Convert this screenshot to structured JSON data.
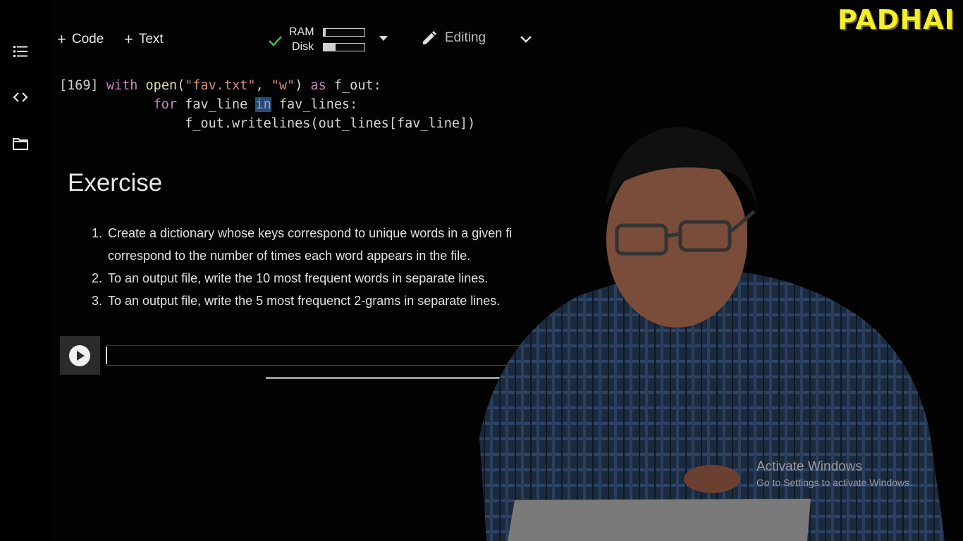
{
  "brand": {
    "logo_text": "PADHAI",
    "logo_color": "#f5ef2a"
  },
  "sidebar": {
    "items": [
      {
        "icon": "table-of-contents-icon"
      },
      {
        "icon": "code-snippets-icon"
      },
      {
        "icon": "folder-icon"
      }
    ]
  },
  "toolbar": {
    "add_code_label": "Code",
    "add_text_label": "Text",
    "resources": {
      "ram_label": "RAM",
      "disk_label": "Disk",
      "ram_usage": 0.05,
      "disk_usage": 0.3,
      "status_icon": "check-icon"
    },
    "mode_label": "Editing"
  },
  "code_cell": {
    "execution_count": "[169]",
    "lines": [
      [
        "with",
        " ",
        "open",
        "(",
        "\"fav.txt\"",
        ", ",
        "\"w\"",
        ") ",
        "as",
        " f_out:"
      ],
      [
        "for",
        " fav_line ",
        "in",
        " fav_lines:"
      ],
      [
        "f_out.writelines(out_lines[fav_line])"
      ]
    ]
  },
  "markdown_cell": {
    "title": "Exercise",
    "items": [
      {
        "num": "1.",
        "text": "Create a dictionary whose keys correspond to unique words in a given fi",
        "continuation": "correspond to the number of times each word appears in the file."
      },
      {
        "num": "2.",
        "text": "To an output file, write the 10 most frequent words in separate lines."
      },
      {
        "num": "3.",
        "text": "To an output file, write the 5 most frequenct 2-grams in separate lines."
      }
    ]
  },
  "overlay": {
    "activate_title": "Activate Windows",
    "activate_sub": "Go to Settings to activate Windows."
  },
  "colors": {
    "background": "#000000",
    "check": "#3fb950",
    "keyword": "#c586c0",
    "function": "#dcdcaa",
    "string": "#ce9178"
  }
}
